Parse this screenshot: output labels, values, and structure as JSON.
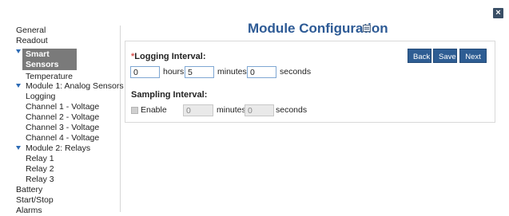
{
  "close_label": "×",
  "sidebar": {
    "items": [
      {
        "label": "General"
      },
      {
        "label": "Readout"
      },
      {
        "label": "Smart Sensors Logging"
      },
      {
        "label": "Temperature"
      },
      {
        "label": "Module 1: Analog Sensors"
      },
      {
        "label": "Logging"
      },
      {
        "label": "Channel 1 - Voltage"
      },
      {
        "label": "Channel 2 - Voltage"
      },
      {
        "label": "Channel 3 - Voltage"
      },
      {
        "label": "Channel 4 - Voltage"
      },
      {
        "label": "Module 2: Relays"
      },
      {
        "label": "Relay 1"
      },
      {
        "label": "Relay 2"
      },
      {
        "label": "Relay 3"
      },
      {
        "label": "Battery"
      },
      {
        "label": "Start/Stop"
      },
      {
        "label": "Alarms"
      }
    ]
  },
  "main": {
    "title": "Module Configuration",
    "title_icon": "page-icon",
    "buttons": {
      "back": "Back",
      "save": "Save",
      "next": "Next"
    },
    "logging": {
      "required_mark": "*",
      "label": "Logging Interval:",
      "hours_value": "0",
      "hours_unit": "hours",
      "minutes_value": "5",
      "minutes_unit": "minutes",
      "seconds_value": "0",
      "seconds_unit": "seconds"
    },
    "sampling": {
      "label": "Sampling Interval:",
      "enable_label": "Enable",
      "enabled": false,
      "minutes_value": "0",
      "minutes_unit": "minutes",
      "seconds_value": "0",
      "seconds_unit": "seconds"
    }
  },
  "colors": {
    "accent": "#2d5a95",
    "button": "#2e5d93",
    "active_nav": "#7a7a7a",
    "caret": "#2d6bb5"
  }
}
